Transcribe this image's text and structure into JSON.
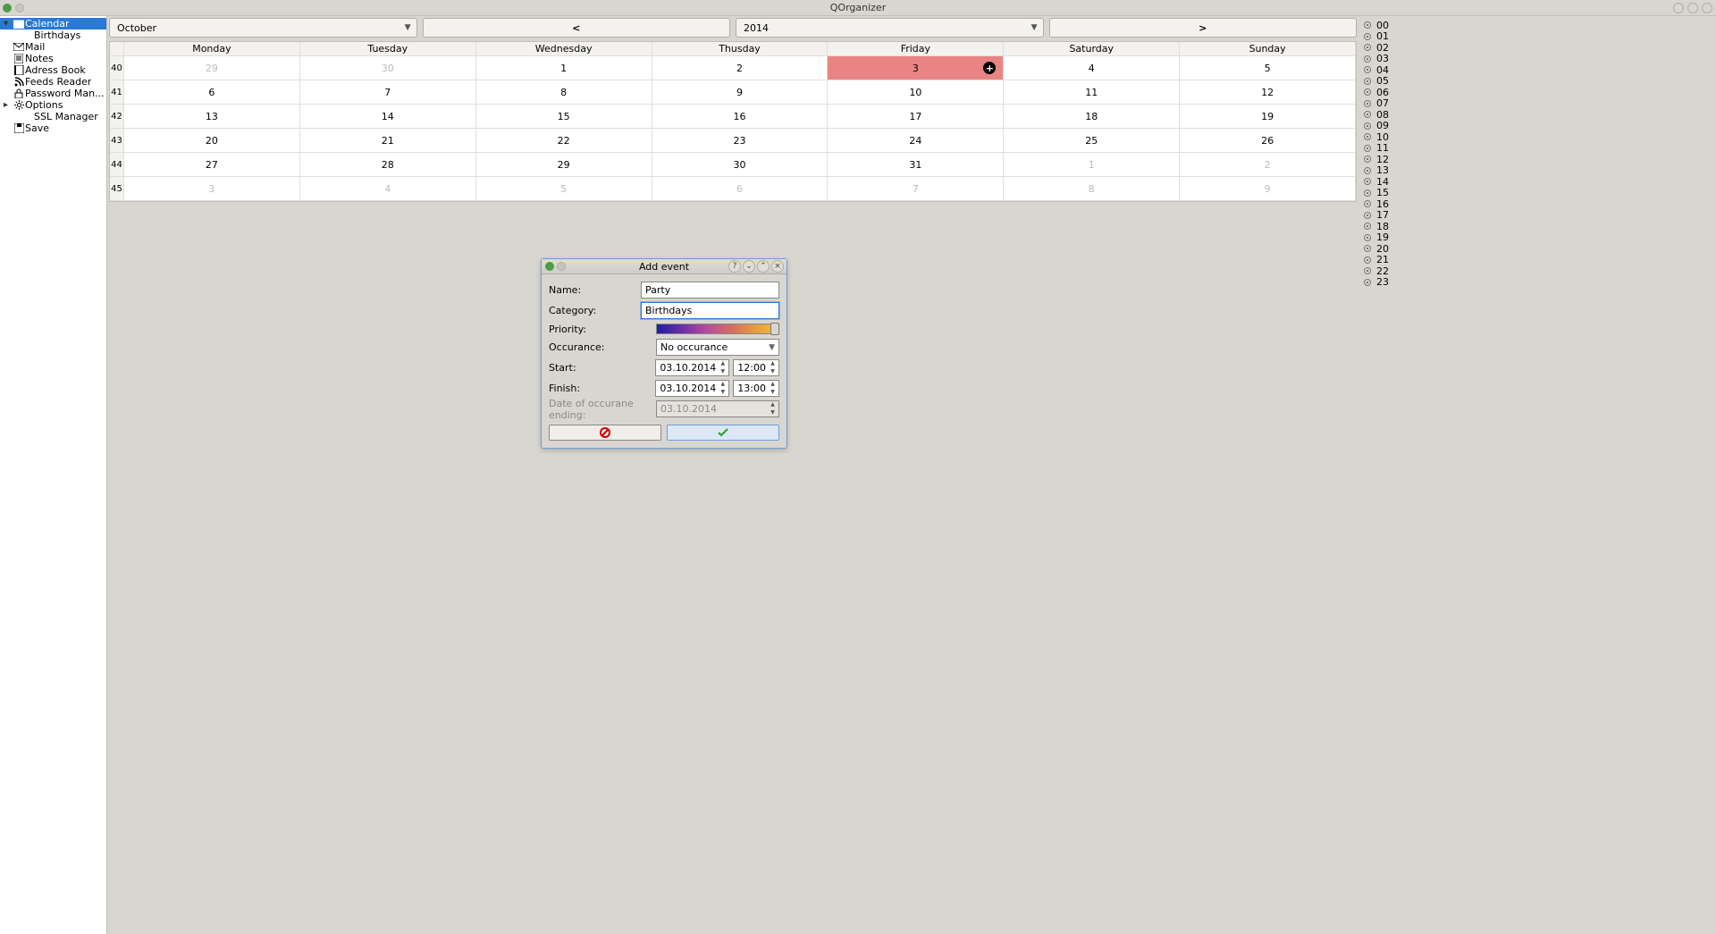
{
  "app_title": "QOrganizer",
  "sidebar": {
    "items": [
      {
        "label": "Calendar",
        "icon": "calendar-icon"
      },
      {
        "label": "Birthdays",
        "icon": ""
      },
      {
        "label": "Mail",
        "icon": "mail-icon"
      },
      {
        "label": "Notes",
        "icon": "notes-icon"
      },
      {
        "label": "Adress Book",
        "icon": "book-icon"
      },
      {
        "label": "Feeds Reader",
        "icon": "feed-icon"
      },
      {
        "label": "Password Man...",
        "icon": "lock-icon"
      },
      {
        "label": "Options",
        "icon": "gear-icon"
      },
      {
        "label": "SSL Manager",
        "icon": ""
      },
      {
        "label": "Save",
        "icon": "save-icon"
      }
    ]
  },
  "toolbar": {
    "month": "October",
    "year": "2014",
    "prev": "<",
    "next": ">"
  },
  "calendar": {
    "day_headers": [
      "Monday",
      "Tuesday",
      "Wednesday",
      "Thusday",
      "Friday",
      "Saturday",
      "Sunday"
    ],
    "weeks": [
      {
        "wk": "40",
        "cells": [
          {
            "n": "29",
            "other": true
          },
          {
            "n": "30",
            "other": true
          },
          {
            "n": "1"
          },
          {
            "n": "2"
          },
          {
            "n": "3",
            "selected": true,
            "add": true
          },
          {
            "n": "4"
          },
          {
            "n": "5"
          }
        ]
      },
      {
        "wk": "41",
        "cells": [
          {
            "n": "6"
          },
          {
            "n": "7"
          },
          {
            "n": "8"
          },
          {
            "n": "9"
          },
          {
            "n": "10"
          },
          {
            "n": "11"
          },
          {
            "n": "12"
          }
        ]
      },
      {
        "wk": "42",
        "cells": [
          {
            "n": "13"
          },
          {
            "n": "14"
          },
          {
            "n": "15"
          },
          {
            "n": "16"
          },
          {
            "n": "17"
          },
          {
            "n": "18"
          },
          {
            "n": "19"
          }
        ]
      },
      {
        "wk": "43",
        "cells": [
          {
            "n": "20"
          },
          {
            "n": "21"
          },
          {
            "n": "22"
          },
          {
            "n": "23"
          },
          {
            "n": "24"
          },
          {
            "n": "25"
          },
          {
            "n": "26"
          }
        ]
      },
      {
        "wk": "44",
        "cells": [
          {
            "n": "27"
          },
          {
            "n": "28"
          },
          {
            "n": "29"
          },
          {
            "n": "30"
          },
          {
            "n": "31"
          },
          {
            "n": "1",
            "other": true
          },
          {
            "n": "2",
            "other": true
          }
        ]
      },
      {
        "wk": "45",
        "cells": [
          {
            "n": "3",
            "other": true
          },
          {
            "n": "4",
            "other": true
          },
          {
            "n": "5",
            "other": true
          },
          {
            "n": "6",
            "other": true
          },
          {
            "n": "7",
            "other": true
          },
          {
            "n": "8",
            "other": true
          },
          {
            "n": "9",
            "other": true
          }
        ]
      }
    ]
  },
  "hours": [
    "00",
    "01",
    "02",
    "03",
    "04",
    "05",
    "06",
    "07",
    "08",
    "09",
    "10",
    "11",
    "12",
    "13",
    "14",
    "15",
    "16",
    "17",
    "18",
    "19",
    "20",
    "21",
    "22",
    "23"
  ],
  "dialog": {
    "title": "Add event",
    "labels": {
      "name": "Name:",
      "category": "Category:",
      "priority": "Priority:",
      "occurance": "Occurance:",
      "start": "Start:",
      "finish": "Finish:",
      "ending": "Date of occurane ending:"
    },
    "values": {
      "name": "Party",
      "category": "Birthdays",
      "occurance": "No occurance",
      "start_date": "03.10.2014",
      "start_time": "12:00",
      "finish_date": "03.10.2014",
      "finish_time": "13:00",
      "ending_date": "03.10.2014"
    }
  }
}
